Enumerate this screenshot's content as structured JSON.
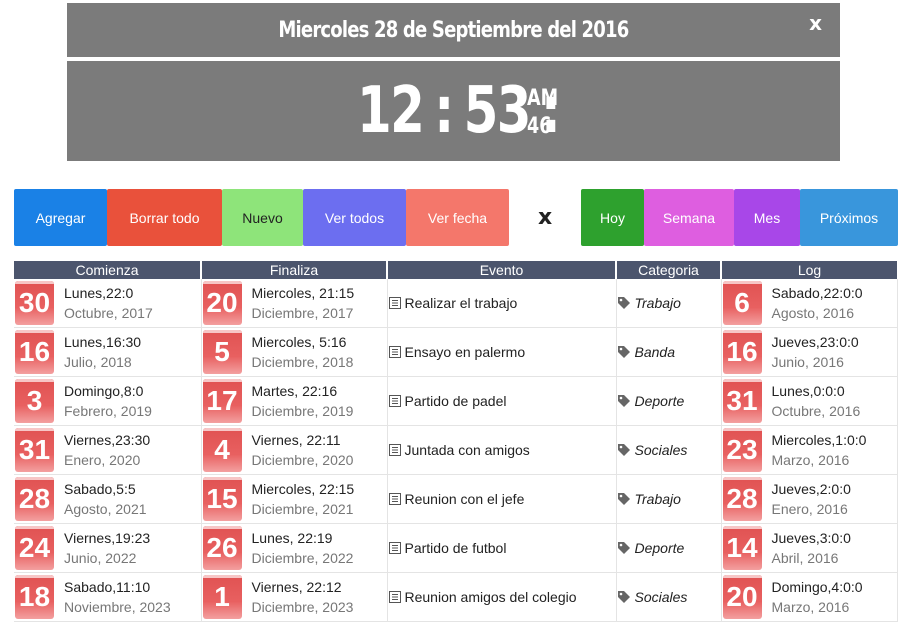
{
  "header": {
    "date_text": "Miercoles 28 de Septiembre del 2016",
    "close_label": "x"
  },
  "clock": {
    "hours": "12",
    "minutes": "53",
    "separator": ":",
    "ampm": "AM",
    "seconds": "46"
  },
  "toolbar": {
    "buttons": [
      {
        "label": "Agregar",
        "color": "#1a81e6"
      },
      {
        "label": "Borrar todo",
        "color": "#e9513b"
      },
      {
        "label": "Nuevo",
        "color": "#8ee47a"
      },
      {
        "label": "Ver todos",
        "color": "#6c6ef0"
      },
      {
        "label": "Ver fecha",
        "color": "#f4776b"
      },
      {
        "label": "Hoy",
        "color": "#2ea12e"
      },
      {
        "label": "Semana",
        "color": "#de5ee0"
      },
      {
        "label": "Mes",
        "color": "#a847e8"
      },
      {
        "label": "Próximos",
        "color": "#3996dc"
      }
    ],
    "close_label": "x"
  },
  "table": {
    "headers": [
      "Comienza",
      "Finaliza",
      "Evento",
      "Categoria",
      "Log"
    ],
    "rows": [
      {
        "start_day": "30",
        "start_l1": "Lunes,22:0",
        "start_l2": "Octubre, 2017",
        "end_day": "20",
        "end_l1": "Miercoles, 21:15",
        "end_l2": "Diciembre, 2017",
        "event": "Realizar el trabajo",
        "category": "Trabajo",
        "log_day": "6",
        "log_l1": "Sabado,22:0:0",
        "log_l2": "Agosto, 2016"
      },
      {
        "start_day": "16",
        "start_l1": "Lunes,16:30",
        "start_l2": "Julio, 2018",
        "end_day": "5",
        "end_l1": "Miercoles, 5:16",
        "end_l2": "Diciembre, 2018",
        "event": "Ensayo en palermo",
        "category": "Banda",
        "log_day": "16",
        "log_l1": "Jueves,23:0:0",
        "log_l2": "Junio, 2016"
      },
      {
        "start_day": "3",
        "start_l1": "Domingo,8:0",
        "start_l2": "Febrero, 2019",
        "end_day": "17",
        "end_l1": "Martes, 22:16",
        "end_l2": "Diciembre, 2019",
        "event": "Partido de padel",
        "category": "Deporte",
        "log_day": "31",
        "log_l1": "Lunes,0:0:0",
        "log_l2": "Octubre, 2016"
      },
      {
        "start_day": "31",
        "start_l1": "Viernes,23:30",
        "start_l2": "Enero, 2020",
        "end_day": "4",
        "end_l1": "Viernes, 22:11",
        "end_l2": "Diciembre, 2020",
        "event": "Juntada con amigos",
        "category": "Sociales",
        "log_day": "23",
        "log_l1": "Miercoles,1:0:0",
        "log_l2": "Marzo, 2016"
      },
      {
        "start_day": "28",
        "start_l1": "Sabado,5:5",
        "start_l2": "Agosto, 2021",
        "end_day": "15",
        "end_l1": "Miercoles, 22:15",
        "end_l2": "Diciembre, 2021",
        "event": "Reunion con el jefe",
        "category": "Trabajo",
        "log_day": "28",
        "log_l1": "Jueves,2:0:0",
        "log_l2": "Enero, 2016"
      },
      {
        "start_day": "24",
        "start_l1": "Viernes,19:23",
        "start_l2": "Junio, 2022",
        "end_day": "26",
        "end_l1": "Lunes, 22:19",
        "end_l2": "Diciembre, 2022",
        "event": "Partido de futbol",
        "category": "Deporte",
        "log_day": "14",
        "log_l1": "Jueves,3:0:0",
        "log_l2": "Abril, 2016"
      },
      {
        "start_day": "18",
        "start_l1": "Sabado,11:10",
        "start_l2": "Noviembre, 2023",
        "end_day": "1",
        "end_l1": "Viernes, 22:12",
        "end_l2": "Diciembre, 2023",
        "event": "Reunion amigos del colegio",
        "category": "Sociales",
        "log_day": "20",
        "log_l1": "Domingo,4:0:0",
        "log_l2": "Marzo, 2016"
      }
    ]
  }
}
